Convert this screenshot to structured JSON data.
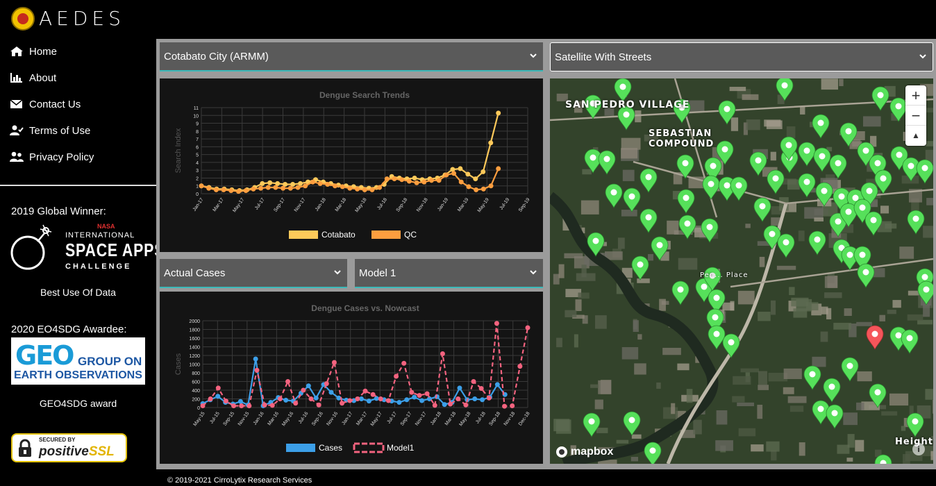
{
  "brand": "AEDES",
  "nav": [
    {
      "label": "Home",
      "icon": "home-icon"
    },
    {
      "label": "About",
      "icon": "chart-icon"
    },
    {
      "label": "Contact Us",
      "icon": "envelope-icon"
    },
    {
      "label": "Terms of Use",
      "icon": "user-check-icon"
    },
    {
      "label": "Privacy Policy",
      "icon": "users-icon"
    }
  ],
  "awards": {
    "winner_title": "2019 Global Winner:",
    "nasa_text": "NASA",
    "spaceapps_line1": "INTERNATIONAL",
    "spaceapps_line2": "SPACE APPS",
    "spaceapps_line3": "CHALLENGE",
    "winner_caption": "Best Use Of Data",
    "awardee_title": "2020 EO4SDG Awardee:",
    "geo_logo": "GEO",
    "geo_line1": "GROUP ON",
    "geo_line2": "EARTH OBSERVATIONS",
    "awardee_caption": "GEO4SDG award",
    "ssl_top": "SECURED BY",
    "ssl_brand": "positive",
    "ssl_brand2": "SSL"
  },
  "selects": {
    "city": "Cotabato City (ARMM)",
    "map_style": "Satellite With Streets",
    "cases_type": "Actual Cases",
    "model": "Model 1"
  },
  "colors": {
    "cotabato": "#fdc95a",
    "qc": "#fd9e3f",
    "cases": "#3c9fe8",
    "model1": "#f4637f",
    "pin_green": "#56e05a",
    "pin_red": "#f5555a"
  },
  "chart_data": [
    {
      "type": "line",
      "title": "Dengue Search Trends",
      "ylabel": "Search Index",
      "xlabel": "",
      "ylim": [
        0,
        11
      ],
      "yticks": [
        0,
        1,
        2,
        3,
        4,
        5,
        6,
        7,
        8,
        9,
        10,
        11
      ],
      "x_tick_labels": [
        "Jan-17",
        "Mar-17",
        "May-17",
        "Jul-17",
        "Sep-17",
        "Nov-17",
        "Jan-18",
        "Mar-18",
        "May-18",
        "Jul-18",
        "Sep-18",
        "Nov-18",
        "Jan-19",
        "Mar-19",
        "May-19",
        "Jul-19",
        "Sep-19"
      ],
      "series": [
        {
          "name": "Cotabato",
          "values": [
            1.0,
            0.8,
            0.6,
            0.6,
            0.5,
            0.4,
            0.5,
            0.8,
            1.3,
            1.4,
            1.3,
            1.2,
            1.2,
            1.3,
            1.5,
            1.8,
            1.5,
            1.3,
            1.1,
            1.0,
            0.9,
            0.8,
            0.7,
            0.8,
            1.2,
            2.2,
            2.0,
            1.9,
            2.0,
            1.8,
            1.9,
            2.0,
            2.4,
            3.1,
            3.2,
            2.5,
            1.9,
            2.8,
            6.5,
            10.3
          ]
        },
        {
          "name": "QC",
          "values": [
            1.0,
            0.7,
            0.5,
            0.5,
            0.4,
            0.3,
            0.4,
            0.6,
            0.7,
            0.8,
            0.8,
            0.7,
            0.7,
            0.8,
            1.0,
            1.5,
            1.3,
            1.2,
            1.0,
            0.9,
            0.7,
            0.6,
            0.5,
            0.5,
            0.8,
            1.9,
            1.9,
            1.8,
            1.6,
            1.4,
            1.5,
            1.7,
            1.7,
            2.4,
            2.6,
            1.5,
            0.9,
            0.5,
            0.6,
            1.0,
            3.2
          ]
        }
      ],
      "legend": [
        "Cotabato",
        "QC"
      ]
    },
    {
      "type": "line",
      "title": "Dengue Cases vs. Nowcast",
      "ylabel": "Cases",
      "xlabel": "",
      "ylim": [
        0,
        2000
      ],
      "yticks": [
        0,
        200,
        400,
        600,
        800,
        1000,
        1200,
        1400,
        1600,
        1800,
        2000
      ],
      "x_tick_labels": [
        "May-15",
        "Jul-15",
        "Sep-15",
        "Nov-15",
        "Jan-16",
        "Mar-16",
        "May-16",
        "Jul-16",
        "Sep-16",
        "Nov-16",
        "Jan-17",
        "Mar-17",
        "May-17",
        "Jul-17",
        "Sep-17",
        "Nov-17",
        "Jan-18",
        "Mar-18",
        "May-18",
        "Jul-18",
        "Sep-18",
        "Nov-18",
        "Dec-18"
      ],
      "series": [
        {
          "name": "Cases",
          "values": [
            90,
            180,
            260,
            120,
            80,
            140,
            60,
            1120,
            40,
            120,
            230,
            170,
            150,
            330,
            500,
            220,
            530,
            350,
            220,
            170,
            160,
            200,
            150,
            210,
            180,
            150,
            120,
            180,
            240,
            160,
            200,
            250,
            70,
            120,
            450,
            180,
            200,
            180,
            240,
            530,
            300
          ]
        },
        {
          "name": "Model1",
          "values": [
            40,
            200,
            450,
            150,
            40,
            40,
            40,
            860,
            60,
            50,
            200,
            600,
            100,
            400,
            200,
            60,
            550,
            1040,
            100,
            160,
            200,
            380,
            300,
            200,
            160,
            720,
            1020,
            350,
            280,
            320,
            50,
            1240,
            80,
            200,
            60,
            600,
            440,
            220,
            1940,
            30,
            40,
            950,
            1840
          ]
        }
      ],
      "legend": [
        "Cases",
        "Model1"
      ]
    }
  ],
  "map": {
    "labels": [
      "SAN PEDRO VILLAGE",
      "SEBASTIAN COMPOUND",
      "Heights",
      "Pen... Place"
    ],
    "attribution": "mapbox",
    "zoom_in": "+",
    "zoom_out": "−",
    "compass": "▲",
    "info": "i"
  },
  "footer": "© 2019-2021 CirroLytix Research Services"
}
